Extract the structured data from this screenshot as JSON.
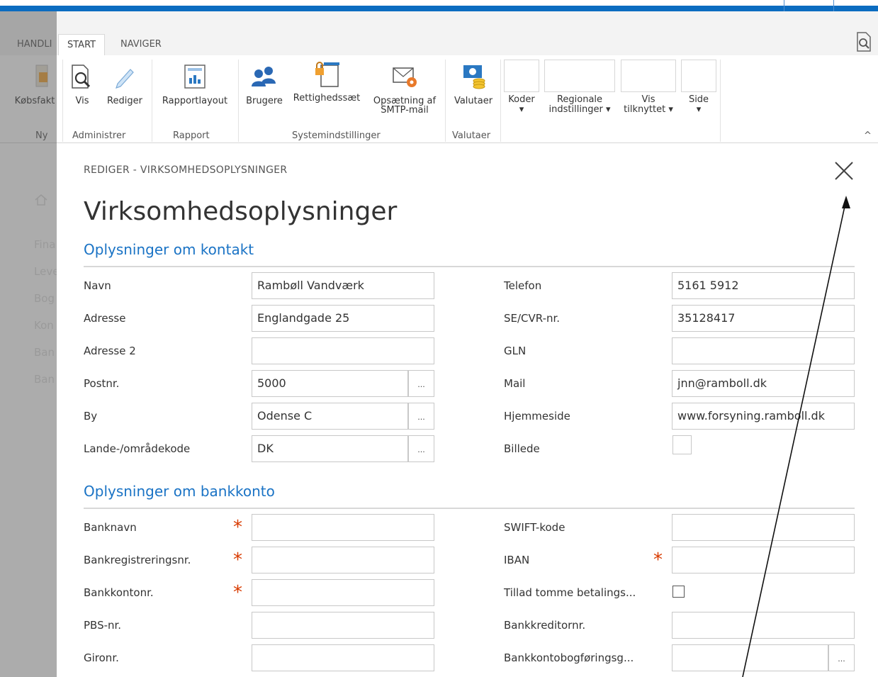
{
  "tabs": [
    "HANDLI",
    "START",
    "NAVIGER"
  ],
  "ribbon": {
    "new_button": "Købsfakt",
    "new_group": "Ny",
    "view": "Vis",
    "edit": "Rediger",
    "administrer_group": "Administrer",
    "report_layout": "Rapportlayout",
    "report_group": "Rapport",
    "users": "Brugere",
    "permission_sets": "Rettighedssæt",
    "smtp_line1": "Opsætning af",
    "smtp_line2": "SMTP-mail",
    "system_group": "Systemindstillinger",
    "currencies": "Valutaer",
    "currencies_group": "Valutaer",
    "codes": "Koder",
    "regional_line1": "Regionale",
    "regional_line2": "indstillinger",
    "show_line1": "Vis",
    "show_line2": "tilknyttet",
    "page": "Side"
  },
  "nav": [
    "Fina",
    "Leve",
    "Bog",
    "Kon",
    "Ban",
    "Ban"
  ],
  "breadcrumb": "REDIGER - VIRKSOMHEDSOPLYSNINGER",
  "title": "Virksomhedsoplysninger",
  "contact": {
    "heading": "Oplysninger om kontakt",
    "name_label": "Navn",
    "name": "Rambøll Vandværk",
    "address_label": "Adresse",
    "address": "Englandgade 25",
    "address2_label": "Adresse 2",
    "address2": "",
    "zip_label": "Postnr.",
    "zip": "5000",
    "city_label": "By",
    "city": "Odense C",
    "country_label": "Lande-/områdekode",
    "country": "DK",
    "phone_label": "Telefon",
    "phone": "5161 5912",
    "vat_label": "SE/CVR-nr.",
    "vat": "35128417",
    "gln_label": "GLN",
    "gln": "",
    "mail_label": "Mail",
    "mail": "jnn@ramboll.dk",
    "homepage_label": "Hjemmeside",
    "homepage": "www.forsyning.ramboll.dk",
    "picture_label": "Billede"
  },
  "bank": {
    "heading": "Oplysninger om bankkonto",
    "bankname_label": "Banknavn",
    "regno_label": "Bankregistreringsnr.",
    "account_label": "Bankkontonr.",
    "pbs_label": "PBS-nr.",
    "giro_label": "Gironr.",
    "swift_label": "SWIFT-kode",
    "iban_label": "IBAN",
    "allow_blank_label": "Tillad tomme betalings...",
    "creditor_label": "Bankkreditornr.",
    "posting_label": "Bankkontobogføringsg..."
  },
  "ellipsis": "...",
  "required_mark": "*",
  "colors": {
    "accent": "#1a73c5",
    "topbar": "#0b6cc0",
    "required": "#d83b01"
  }
}
